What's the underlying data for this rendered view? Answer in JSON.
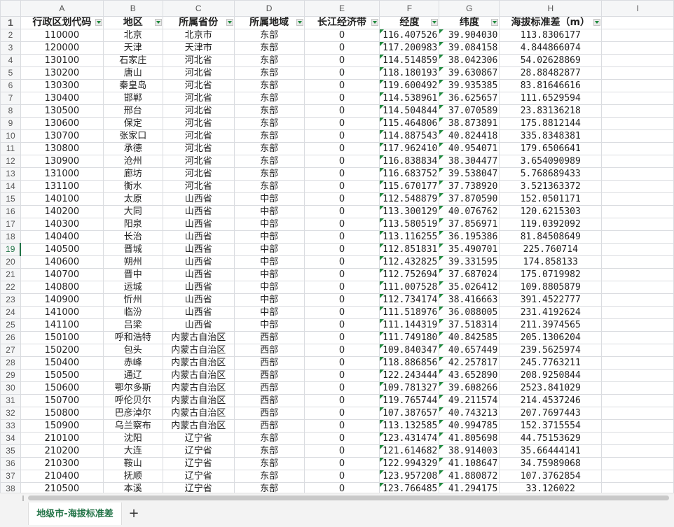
{
  "columns": [
    "A",
    "B",
    "C",
    "D",
    "E",
    "F",
    "G",
    "H",
    "I"
  ],
  "header_row": {
    "row_num": "1",
    "cells": [
      "行政区划代码",
      "地区",
      "所属省份",
      "所属地域",
      "长江经济带",
      "经度",
      "纬度",
      "海拔标准差（m）"
    ]
  },
  "rows": [
    {
      "n": "2",
      "code": "110000",
      "city": "北京",
      "prov": "北京市",
      "region": "东部",
      "yz": "0",
      "lng": "116.407526",
      "lat": "39.904030",
      "alt": "113.8306177"
    },
    {
      "n": "3",
      "code": "120000",
      "city": "天津",
      "prov": "天津市",
      "region": "东部",
      "yz": "0",
      "lng": "117.200983",
      "lat": "39.084158",
      "alt": "4.844866074"
    },
    {
      "n": "4",
      "code": "130100",
      "city": "石家庄",
      "prov": "河北省",
      "region": "东部",
      "yz": "0",
      "lng": "114.514859",
      "lat": "38.042306",
      "alt": "54.02628869"
    },
    {
      "n": "5",
      "code": "130200",
      "city": "唐山",
      "prov": "河北省",
      "region": "东部",
      "yz": "0",
      "lng": "118.180193",
      "lat": "39.630867",
      "alt": "28.88482877"
    },
    {
      "n": "6",
      "code": "130300",
      "city": "秦皇岛",
      "prov": "河北省",
      "region": "东部",
      "yz": "0",
      "lng": "119.600492",
      "lat": "39.935385",
      "alt": "83.81646616"
    },
    {
      "n": "7",
      "code": "130400",
      "city": "邯郸",
      "prov": "河北省",
      "region": "东部",
      "yz": "0",
      "lng": "114.538961",
      "lat": "36.625657",
      "alt": "111.6529594"
    },
    {
      "n": "8",
      "code": "130500",
      "city": "邢台",
      "prov": "河北省",
      "region": "东部",
      "yz": "0",
      "lng": "114.504844",
      "lat": "37.070589",
      "alt": "23.83136218"
    },
    {
      "n": "9",
      "code": "130600",
      "city": "保定",
      "prov": "河北省",
      "region": "东部",
      "yz": "0",
      "lng": "115.464806",
      "lat": "38.873891",
      "alt": "175.8812144"
    },
    {
      "n": "10",
      "code": "130700",
      "city": "张家口",
      "prov": "河北省",
      "region": "东部",
      "yz": "0",
      "lng": "114.887543",
      "lat": "40.824418",
      "alt": "335.8348381"
    },
    {
      "n": "11",
      "code": "130800",
      "city": "承德",
      "prov": "河北省",
      "region": "东部",
      "yz": "0",
      "lng": "117.962410",
      "lat": "40.954071",
      "alt": "179.6506641"
    },
    {
      "n": "12",
      "code": "130900",
      "city": "沧州",
      "prov": "河北省",
      "region": "东部",
      "yz": "0",
      "lng": "116.838834",
      "lat": "38.304477",
      "alt": "3.654090989"
    },
    {
      "n": "13",
      "code": "131000",
      "city": "廊坊",
      "prov": "河北省",
      "region": "东部",
      "yz": "0",
      "lng": "116.683752",
      "lat": "39.538047",
      "alt": "5.768689433"
    },
    {
      "n": "14",
      "code": "131100",
      "city": "衡水",
      "prov": "河北省",
      "region": "东部",
      "yz": "0",
      "lng": "115.670177",
      "lat": "37.738920",
      "alt": "3.521363372"
    },
    {
      "n": "15",
      "code": "140100",
      "city": "太原",
      "prov": "山西省",
      "region": "中部",
      "yz": "0",
      "lng": "112.548879",
      "lat": "37.870590",
      "alt": "152.0501171"
    },
    {
      "n": "16",
      "code": "140200",
      "city": "大同",
      "prov": "山西省",
      "region": "中部",
      "yz": "0",
      "lng": "113.300129",
      "lat": "40.076762",
      "alt": "120.6215303"
    },
    {
      "n": "17",
      "code": "140300",
      "city": "阳泉",
      "prov": "山西省",
      "region": "中部",
      "yz": "0",
      "lng": "113.580519",
      "lat": "37.856971",
      "alt": "119.0392092"
    },
    {
      "n": "18",
      "code": "140400",
      "city": "长治",
      "prov": "山西省",
      "region": "中部",
      "yz": "0",
      "lng": "113.116255",
      "lat": "36.195386",
      "alt": "81.84508649"
    },
    {
      "n": "19",
      "code": "140500",
      "city": "晋城",
      "prov": "山西省",
      "region": "中部",
      "yz": "0",
      "lng": "112.851831",
      "lat": "35.490701",
      "alt": "225.760714"
    },
    {
      "n": "20",
      "code": "140600",
      "city": "朔州",
      "prov": "山西省",
      "region": "中部",
      "yz": "0",
      "lng": "112.432825",
      "lat": "39.331595",
      "alt": "174.858133"
    },
    {
      "n": "21",
      "code": "140700",
      "city": "晋中",
      "prov": "山西省",
      "region": "中部",
      "yz": "0",
      "lng": "112.752694",
      "lat": "37.687024",
      "alt": "175.0719982"
    },
    {
      "n": "22",
      "code": "140800",
      "city": "运城",
      "prov": "山西省",
      "region": "中部",
      "yz": "0",
      "lng": "111.007528",
      "lat": "35.026412",
      "alt": "109.8805879"
    },
    {
      "n": "23",
      "code": "140900",
      "city": "忻州",
      "prov": "山西省",
      "region": "中部",
      "yz": "0",
      "lng": "112.734174",
      "lat": "38.416663",
      "alt": "391.4522777"
    },
    {
      "n": "24",
      "code": "141000",
      "city": "临汾",
      "prov": "山西省",
      "region": "中部",
      "yz": "0",
      "lng": "111.518976",
      "lat": "36.088005",
      "alt": "231.4192624"
    },
    {
      "n": "25",
      "code": "141100",
      "city": "吕梁",
      "prov": "山西省",
      "region": "中部",
      "yz": "0",
      "lng": "111.144319",
      "lat": "37.518314",
      "alt": "211.3974565"
    },
    {
      "n": "26",
      "code": "150100",
      "city": "呼和浩特",
      "prov": "内蒙古自治区",
      "region": "西部",
      "yz": "0",
      "lng": "111.749180",
      "lat": "40.842585",
      "alt": "205.1306204"
    },
    {
      "n": "27",
      "code": "150200",
      "city": "包头",
      "prov": "内蒙古自治区",
      "region": "西部",
      "yz": "0",
      "lng": "109.840347",
      "lat": "40.657449",
      "alt": "239.5625974"
    },
    {
      "n": "28",
      "code": "150400",
      "city": "赤峰",
      "prov": "内蒙古自治区",
      "region": "西部",
      "yz": "0",
      "lng": "118.886856",
      "lat": "42.257817",
      "alt": "245.7763211"
    },
    {
      "n": "29",
      "code": "150500",
      "city": "通辽",
      "prov": "内蒙古自治区",
      "region": "西部",
      "yz": "0",
      "lng": "122.243444",
      "lat": "43.652890",
      "alt": "208.9250844"
    },
    {
      "n": "30",
      "code": "150600",
      "city": "鄂尔多斯",
      "prov": "内蒙古自治区",
      "region": "西部",
      "yz": "0",
      "lng": "109.781327",
      "lat": "39.608266",
      "alt": "2523.841029"
    },
    {
      "n": "31",
      "code": "150700",
      "city": "呼伦贝尔",
      "prov": "内蒙古自治区",
      "region": "西部",
      "yz": "0",
      "lng": "119.765744",
      "lat": "49.211574",
      "alt": "214.4537246"
    },
    {
      "n": "32",
      "code": "150800",
      "city": "巴彦淖尔",
      "prov": "内蒙古自治区",
      "region": "西部",
      "yz": "0",
      "lng": "107.387657",
      "lat": "40.743213",
      "alt": "207.7697443"
    },
    {
      "n": "33",
      "code": "150900",
      "city": "乌兰察布",
      "prov": "内蒙古自治区",
      "region": "西部",
      "yz": "0",
      "lng": "113.132585",
      "lat": "40.994785",
      "alt": "152.3715554"
    },
    {
      "n": "34",
      "code": "210100",
      "city": "沈阳",
      "prov": "辽宁省",
      "region": "东部",
      "yz": "0",
      "lng": "123.431474",
      "lat": "41.805698",
      "alt": "44.75153629"
    },
    {
      "n": "35",
      "code": "210200",
      "city": "大连",
      "prov": "辽宁省",
      "region": "东部",
      "yz": "0",
      "lng": "121.614682",
      "lat": "38.914003",
      "alt": "35.66444141"
    },
    {
      "n": "36",
      "code": "210300",
      "city": "鞍山",
      "prov": "辽宁省",
      "region": "东部",
      "yz": "0",
      "lng": "122.994329",
      "lat": "41.108647",
      "alt": "34.75989068"
    },
    {
      "n": "37",
      "code": "210400",
      "city": "抚顺",
      "prov": "辽宁省",
      "region": "东部",
      "yz": "0",
      "lng": "123.957208",
      "lat": "41.880872",
      "alt": "107.3762854"
    },
    {
      "n": "38",
      "code": "210500",
      "city": "本溪",
      "prov": "辽宁省",
      "region": "东部",
      "yz": "0",
      "lng": "123.766485",
      "lat": "41.294175",
      "alt": "33.126022"
    }
  ],
  "selected_row": "19",
  "sheet_tab": "地级市-海拔标准差",
  "add_sheet_label": "+",
  "colors": {
    "accent": "#217346",
    "filter_arrow": "#1e8a3c"
  }
}
